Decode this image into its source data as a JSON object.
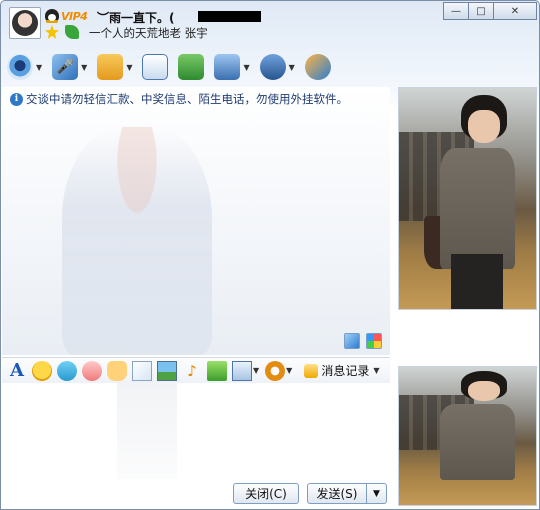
{
  "header": {
    "vip_label": "VIP4",
    "nickname": "︶雨一直下。(",
    "signature": "一个人的天荒地老 张宇"
  },
  "window_controls": {
    "minimize": "—",
    "maximize": "□",
    "close": "✕"
  },
  "toolbar": {
    "items": [
      {
        "name": "webcam-icon",
        "has_menu": true
      },
      {
        "name": "microphone-icon",
        "has_menu": true
      },
      {
        "name": "folder-icon",
        "has_menu": true
      },
      {
        "name": "mail-icon",
        "has_menu": false
      },
      {
        "name": "app-icon",
        "has_menu": false
      },
      {
        "name": "group-icon",
        "has_menu": true
      },
      {
        "name": "settings-icon",
        "has_menu": true
      },
      {
        "name": "share-icon",
        "has_menu": false
      }
    ]
  },
  "notice": {
    "icon_text": "i",
    "text": "交谈中请勿轻信汇款、中奖信息、陌生电话，勿使用外挂软件。"
  },
  "format_bar": {
    "font_label": "A",
    "history_label": "消息记录",
    "music_glyph": "♪"
  },
  "buttons": {
    "close": "关闭(C)",
    "send": "发送(S)",
    "send_menu": "▼"
  },
  "colors": {
    "title_bg": "#dfe9f5",
    "notice_text": "#1f3c72",
    "vip": "#f08c00",
    "border": "#7a8ea8"
  }
}
